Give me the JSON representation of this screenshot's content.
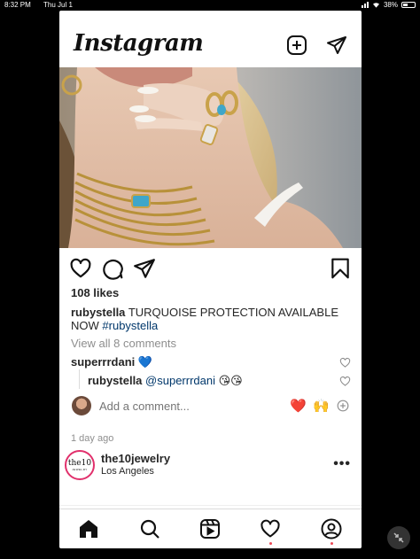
{
  "status_bar": {
    "time": "8:32 PM",
    "date": "Thu Jul 1",
    "battery": "38%",
    "battery_level": 0.38
  },
  "header": {
    "logo": "Instagram",
    "new_post_icon": "plus-square-icon",
    "direct_icon": "paper-plane-icon"
  },
  "post": {
    "likes": "108 likes",
    "caption_user": "rubystella",
    "caption_text": "TURQUOISE PROTECTION AVAILABLE NOW",
    "caption_tag": "#rubystella",
    "view_all": "View all 8 comments",
    "comments": [
      {
        "user": "superrrdani",
        "text": "💙"
      }
    ],
    "reply": {
      "user": "rubystella",
      "mention": "@superrrdani",
      "text": "😘😘"
    },
    "add_comment_placeholder": "Add a comment...",
    "quick_emojis": [
      "❤️",
      "🙌"
    ],
    "time_ago": "1 day ago"
  },
  "next_post": {
    "avatar_line1": "the10",
    "avatar_line2": "JEWELRY",
    "username": "the10jewelry",
    "location": "Los Angeles"
  },
  "tabbar": {
    "items": [
      "home-icon",
      "search-icon",
      "reels-icon",
      "heart-icon",
      "profile-icon"
    ]
  },
  "colors": {
    "link": "#00376b",
    "muted": "#8e8e8e",
    "notify": "#ed4956",
    "turquoise": "#3fa6c9"
  }
}
